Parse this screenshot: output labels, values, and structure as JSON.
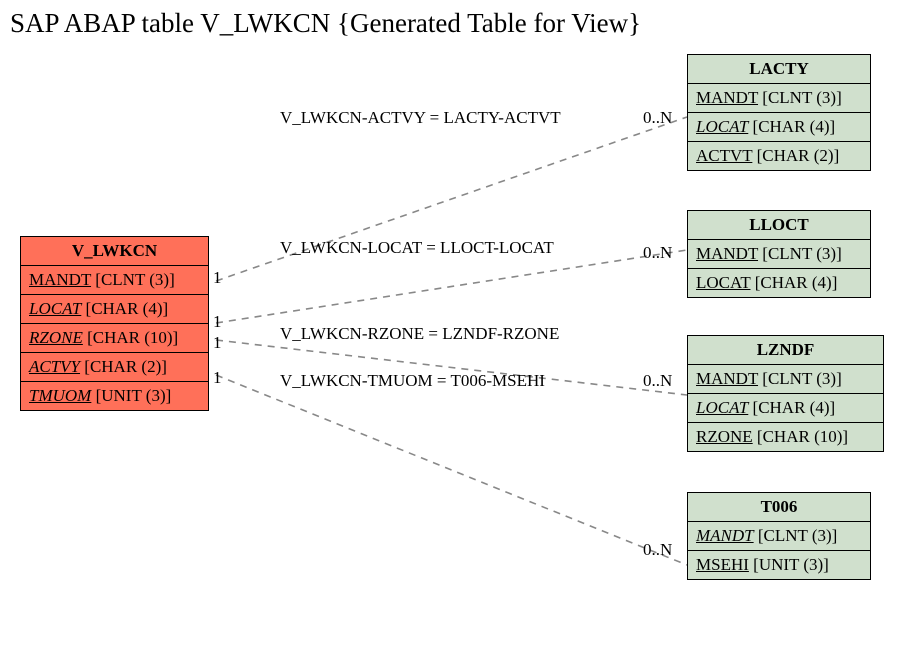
{
  "title": "SAP ABAP table V_LWKCN {Generated Table for View}",
  "main_entity": {
    "name": "V_LWKCN",
    "fields": [
      {
        "name": "MANDT",
        "type": "[CLNT (3)]",
        "italic": false
      },
      {
        "name": "LOCAT",
        "type": "[CHAR (4)]",
        "italic": true
      },
      {
        "name": "RZONE",
        "type": "[CHAR (10)]",
        "italic": true
      },
      {
        "name": "ACTVY",
        "type": "[CHAR (2)]",
        "italic": true
      },
      {
        "name": "TMUOM",
        "type": "[UNIT (3)]",
        "italic": true
      }
    ]
  },
  "ref_entities": [
    {
      "name": "LACTY",
      "fields": [
        {
          "name": "MANDT",
          "type": "[CLNT (3)]",
          "italic": false
        },
        {
          "name": "LOCAT",
          "type": "[CHAR (4)]",
          "italic": true
        },
        {
          "name": "ACTVT",
          "type": "[CHAR (2)]",
          "italic": false
        }
      ]
    },
    {
      "name": "LLOCT",
      "fields": [
        {
          "name": "MANDT",
          "type": "[CLNT (3)]",
          "italic": false
        },
        {
          "name": "LOCAT",
          "type": "[CHAR (4)]",
          "italic": false
        }
      ]
    },
    {
      "name": "LZNDF",
      "fields": [
        {
          "name": "MANDT",
          "type": "[CLNT (3)]",
          "italic": false
        },
        {
          "name": "LOCAT",
          "type": "[CHAR (4)]",
          "italic": true
        },
        {
          "name": "RZONE",
          "type": "[CHAR (10)]",
          "italic": false
        }
      ]
    },
    {
      "name": "T006",
      "fields": [
        {
          "name": "MANDT",
          "type": "[CLNT (3)]",
          "italic": true
        },
        {
          "name": "MSEHI",
          "type": "[UNIT (3)]",
          "italic": false
        }
      ]
    }
  ],
  "relations": [
    {
      "label": "V_LWKCN-ACTVY = LACTY-ACTVT",
      "left_card": "1",
      "right_card": "0..N"
    },
    {
      "label": "V_LWKCN-LOCAT = LLOCT-LOCAT",
      "left_card": "1",
      "right_card": "0..N"
    },
    {
      "label": "V_LWKCN-RZONE = LZNDF-RZONE",
      "left_card": "1",
      "right_card": "0..N"
    },
    {
      "label": "V_LWKCN-TMUOM = T006-MSEHI",
      "left_card": "1",
      "right_card": "0..N"
    }
  ]
}
